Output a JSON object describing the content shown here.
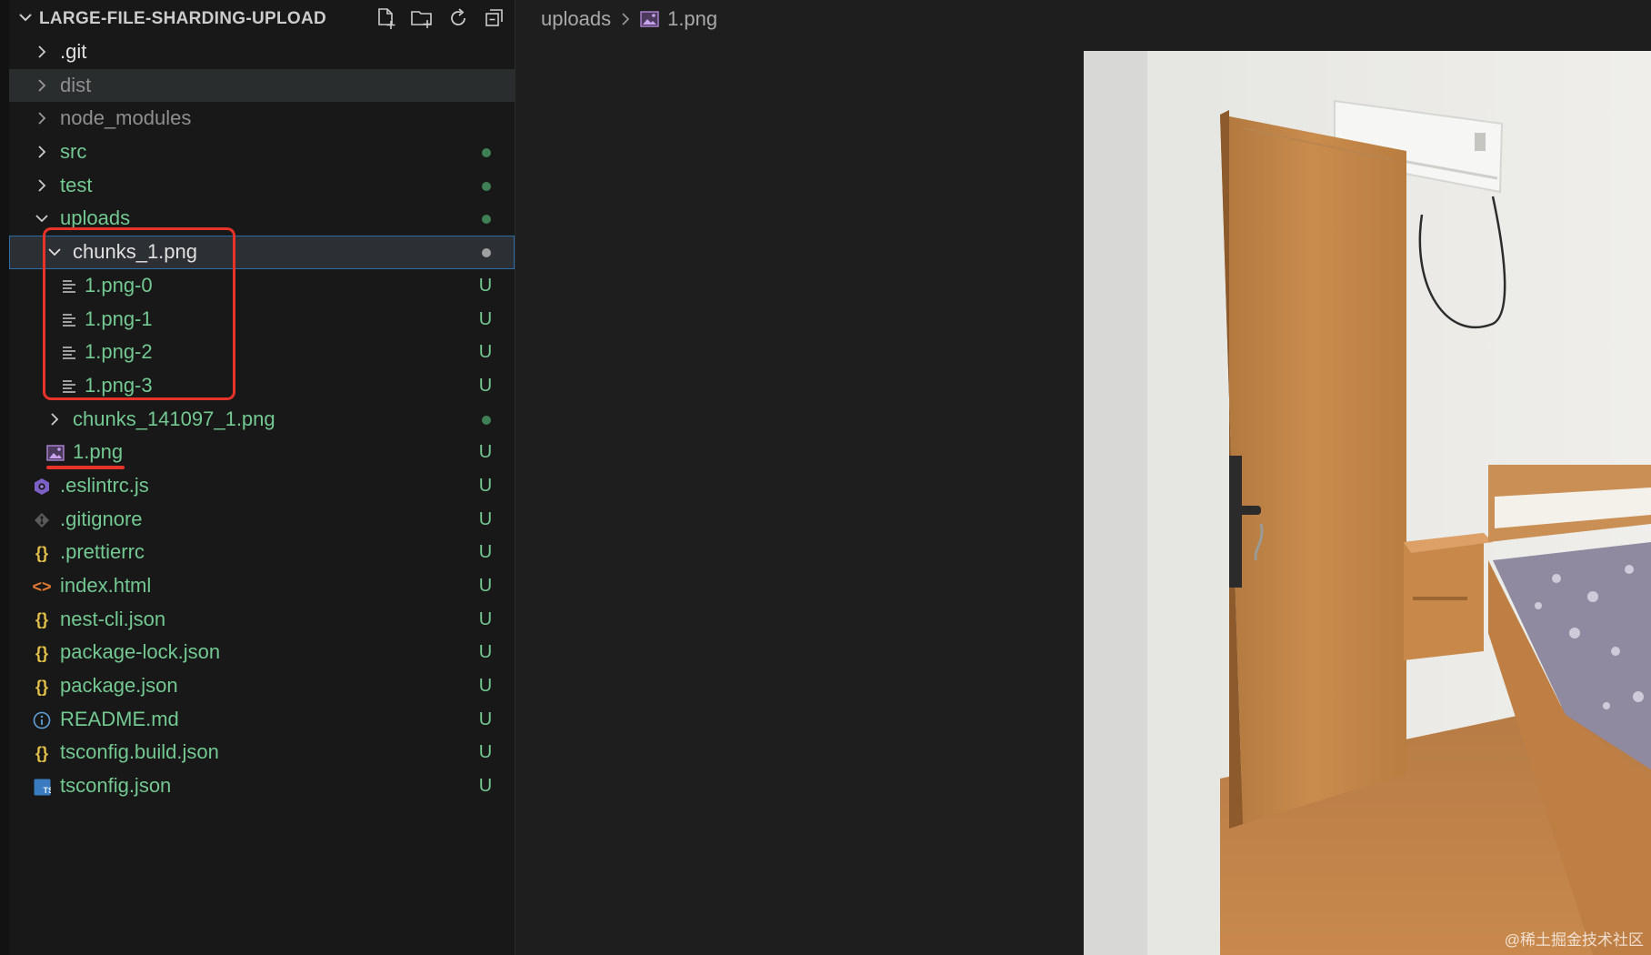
{
  "explorer": {
    "title": "LARGE-FILE-SHARDING-UPLOAD",
    "actions": [
      "new-file-icon",
      "new-folder-icon",
      "refresh-icon",
      "collapse-all-icon"
    ],
    "items": [
      {
        "label": ".git",
        "kind": "folder",
        "state": "collapsed",
        "depth": 0,
        "badge": ""
      },
      {
        "label": "dist",
        "kind": "folder",
        "state": "collapsed",
        "depth": 0,
        "badge": ""
      },
      {
        "label": "node_modules",
        "kind": "folder",
        "state": "collapsed",
        "depth": 0,
        "badge": ""
      },
      {
        "label": "src",
        "kind": "folder",
        "state": "collapsed",
        "depth": 0,
        "badge": "dot"
      },
      {
        "label": "test",
        "kind": "folder",
        "state": "collapsed",
        "depth": 0,
        "badge": "dot"
      },
      {
        "label": "uploads",
        "kind": "folder",
        "state": "expanded",
        "depth": 0,
        "badge": "dot"
      },
      {
        "label": "chunks_1.png",
        "kind": "folder",
        "state": "expanded",
        "depth": 1,
        "badge": "dot"
      },
      {
        "label": "1.png-0",
        "kind": "file",
        "icon": "text-file-icon",
        "depth": 2,
        "badge": "U"
      },
      {
        "label": "1.png-1",
        "kind": "file",
        "icon": "text-file-icon",
        "depth": 2,
        "badge": "U"
      },
      {
        "label": "1.png-2",
        "kind": "file",
        "icon": "text-file-icon",
        "depth": 2,
        "badge": "U"
      },
      {
        "label": "1.png-3",
        "kind": "file",
        "icon": "text-file-icon",
        "depth": 2,
        "badge": "U"
      },
      {
        "label": "chunks_141097_1.png",
        "kind": "folder",
        "state": "collapsed",
        "depth": 1,
        "badge": "dot"
      },
      {
        "label": "1.png",
        "kind": "file",
        "icon": "image-file-icon",
        "depth": 1,
        "badge": "U"
      },
      {
        "label": ".eslintrc.js",
        "kind": "file",
        "icon": "eslint-icon",
        "depth": 0,
        "badge": "U"
      },
      {
        "label": ".gitignore",
        "kind": "file",
        "icon": "git-icon",
        "depth": 0,
        "badge": "U"
      },
      {
        "label": ".prettierrc",
        "kind": "file",
        "icon": "json-icon",
        "depth": 0,
        "badge": "U"
      },
      {
        "label": "index.html",
        "kind": "file",
        "icon": "html-icon",
        "depth": 0,
        "badge": "U"
      },
      {
        "label": "nest-cli.json",
        "kind": "file",
        "icon": "json-icon",
        "depth": 0,
        "badge": "U"
      },
      {
        "label": "package-lock.json",
        "kind": "file",
        "icon": "json-icon",
        "depth": 0,
        "badge": "U"
      },
      {
        "label": "package.json",
        "kind": "file",
        "icon": "json-icon",
        "depth": 0,
        "badge": "U"
      },
      {
        "label": "README.md",
        "kind": "file",
        "icon": "info-icon",
        "depth": 0,
        "badge": "U"
      },
      {
        "label": "tsconfig.build.json",
        "kind": "file",
        "icon": "json-icon",
        "depth": 0,
        "badge": "U"
      },
      {
        "label": "tsconfig.json",
        "kind": "file",
        "icon": "typescript-icon",
        "depth": 0,
        "badge": "U"
      }
    ]
  },
  "editor": {
    "breadcrumb": {
      "folder": "uploads",
      "file": "1.png"
    },
    "preview": {
      "alt": "bedroom-photo",
      "watermark": "@稀土掘金技术社区"
    }
  },
  "colors": {
    "untracked": "#73c991",
    "annotation": "#e8332a",
    "selection_border": "#2e6ca8"
  }
}
